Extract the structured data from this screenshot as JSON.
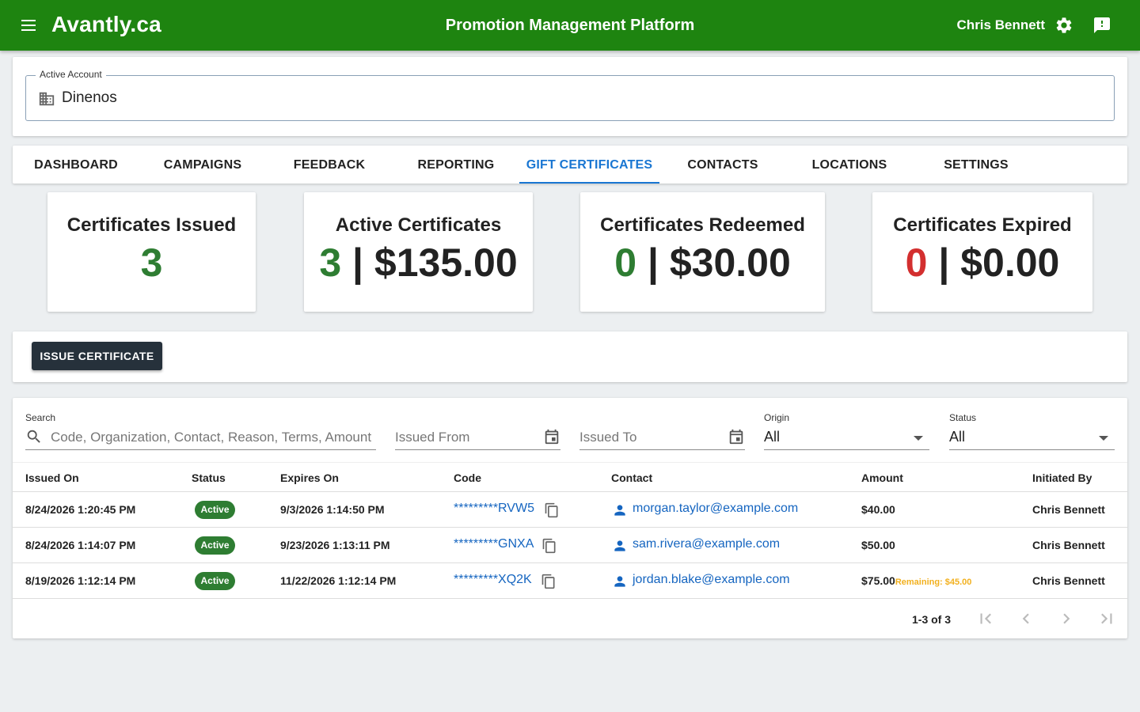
{
  "header": {
    "brand": "Avantly.ca",
    "app_title": "Promotion Management Platform",
    "user_name": "Chris Bennett",
    "icons": [
      "menu-icon",
      "settings-icon",
      "feedback-icon"
    ],
    "color": "#1e8410"
  },
  "account": {
    "label": "Active Account",
    "value": "Dinenos",
    "icon": "building-icon"
  },
  "tabs": [
    {
      "label": "DASHBOARD"
    },
    {
      "label": "CAMPAIGNS"
    },
    {
      "label": "FEEDBACK"
    },
    {
      "label": "REPORTING"
    },
    {
      "label": "GIFT CERTIFICATES",
      "active": true
    },
    {
      "label": "CONTACTS"
    },
    {
      "label": "LOCATIONS"
    },
    {
      "label": "SETTINGS"
    }
  ],
  "stats": {
    "issued": {
      "title": "Certificates Issued",
      "count": "3"
    },
    "active": {
      "title": "Active Certificates",
      "count": "3",
      "amount": "| $135.00"
    },
    "redeemed": {
      "title": "Certificates Redeemed",
      "count": "0",
      "amount": "| $30.00"
    },
    "expired": {
      "title": "Certificates Expired",
      "count": "0",
      "amount": "| $0.00"
    }
  },
  "actions": {
    "issue_label": "ISSUE CERTIFICATE"
  },
  "filters": {
    "search_label": "Search",
    "search_placeholder": "Code, Organization, Contact, Reason, Terms, Amount",
    "issued_from": "Issued From",
    "issued_to": "Issued To",
    "origin_label": "Origin",
    "origin_value": "All",
    "status_label": "Status",
    "status_value": "All"
  },
  "table": {
    "columns": [
      "Issued On",
      "Status",
      "Expires On",
      "Code",
      "Contact",
      "Amount",
      "Initiated By"
    ],
    "rows": [
      {
        "issued_on": "8/24/2026 1:20:45 PM",
        "status": "Active",
        "expires_on": "9/3/2026 1:14:50 PM",
        "code": "*********RVW5",
        "contact": "morgan.taylor@example.com",
        "amount": "$40.00",
        "remaining": "",
        "initiated_by": "Chris Bennett"
      },
      {
        "issued_on": "8/24/2026 1:14:07 PM",
        "status": "Active",
        "expires_on": "9/23/2026 1:13:11 PM",
        "code": "*********GNXA",
        "contact": "sam.rivera@example.com",
        "amount": "$50.00",
        "remaining": "",
        "initiated_by": "Chris Bennett"
      },
      {
        "issued_on": "8/19/2026 1:12:14 PM",
        "status": "Active",
        "expires_on": "11/22/2026 1:12:14 PM",
        "code": "*********XQ2K",
        "contact": "jordan.blake@example.com",
        "amount": "$75.00",
        "remaining": "Remaining: $45.00",
        "initiated_by": "Chris Bennett"
      }
    ]
  },
  "pagination": {
    "text": "1-3 of 3"
  }
}
